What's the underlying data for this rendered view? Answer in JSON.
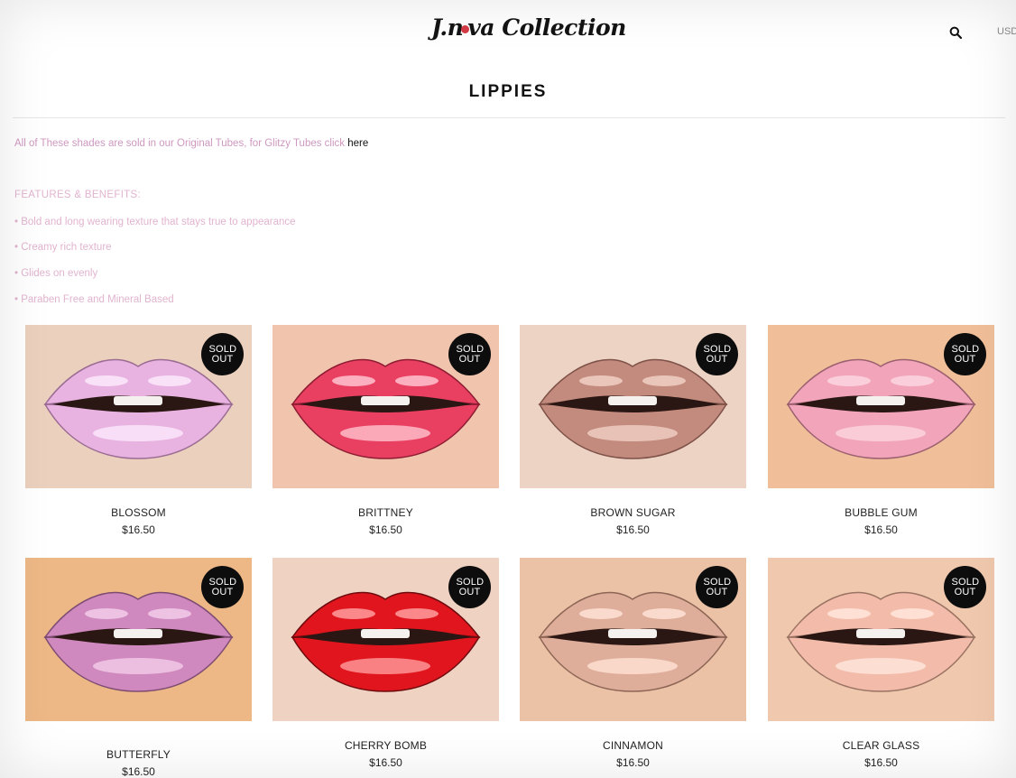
{
  "header": {
    "logo_text": "J.nova Collection",
    "currency": "USD"
  },
  "page_title": "LIPPIES",
  "intro": {
    "text": "All of These shades are sold in our Original Tubes, for Glitzy Tubes click",
    "link_text": "here"
  },
  "features": {
    "title": "FEATURES & BENEFITS:",
    "items": [
      "• Bold and long wearing texture that stays true to appearance",
      "• Creamy rich texture",
      "• Glides on evenly",
      "• Paraben Free and Mineral Based"
    ]
  },
  "products": [
    {
      "name": "BLOSSOM",
      "price": "$16.50",
      "badge": "SOLD OUT",
      "skin": "#ecd0be",
      "lip": "#e8b3e0",
      "shine": "#fbe9fb",
      "edge": "#9b6c93"
    },
    {
      "name": "BRITTNEY",
      "price": "$16.50",
      "badge": "SOLD OUT",
      "skin": "#f1c5ad",
      "lip": "#e93f61",
      "shine": "#ffc3cf",
      "edge": "#8e1d33"
    },
    {
      "name": "BROWN SUGAR",
      "price": "$16.50",
      "badge": "SOLD OUT",
      "skin": "#edd3c4",
      "lip": "#c38a7e",
      "shine": "#f1cfc4",
      "edge": "#7e5248"
    },
    {
      "name": "BUBBLE GUM",
      "price": "$16.50",
      "badge": "SOLD OUT",
      "skin": "#f0bf99",
      "lip": "#f2a5ba",
      "shine": "#fbd6e0",
      "edge": "#9c6070"
    },
    {
      "name": "BUTTERFLY",
      "price": "$16.50",
      "badge": "SOLD OUT",
      "skin": "#edb886",
      "lip": "#cf89be",
      "shine": "#f2cdea",
      "edge": "#7e4c73"
    },
    {
      "name": "CHERRY BOMB",
      "price": "$16.50",
      "badge": "SOLD OUT",
      "skin": "#efd2c2",
      "lip": "#e0151d",
      "shine": "#ff9c9e",
      "edge": "#6e0b0e"
    },
    {
      "name": "CINNAMON",
      "price": "$16.50",
      "badge": "SOLD OUT",
      "skin": "#ecc2a7",
      "lip": "#deae9a",
      "shine": "#ffe2d6",
      "edge": "#8d6655"
    },
    {
      "name": "CLEAR GLASS",
      "price": "$16.50",
      "badge": "SOLD OUT",
      "skin": "#f0c8ad",
      "lip": "#f3bcaa",
      "shine": "#ffe6dc",
      "edge": "#9b7464"
    }
  ]
}
